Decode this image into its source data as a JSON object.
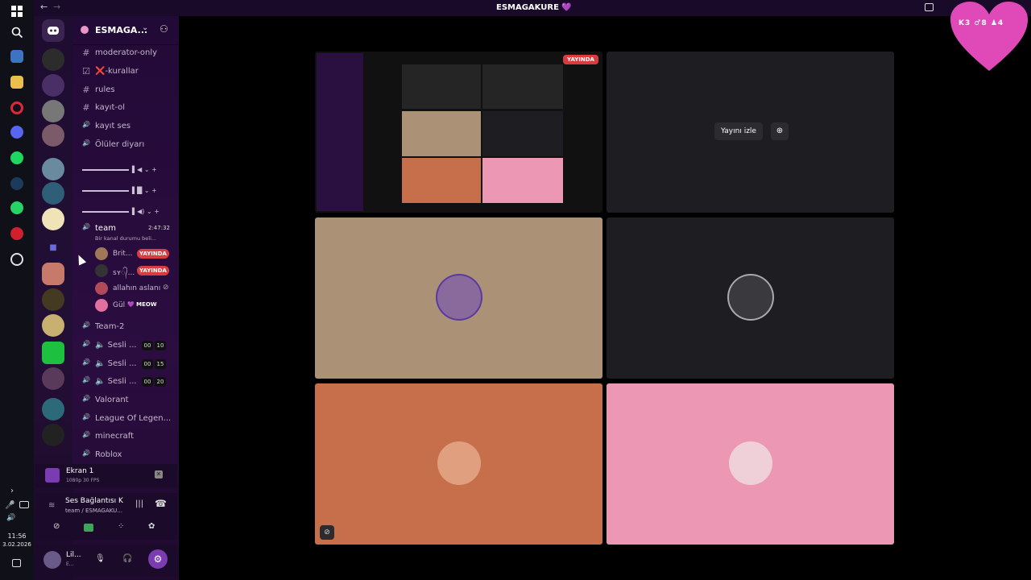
{
  "window": {
    "title": "ESMAGAKURE 💜",
    "nav_back": "←",
    "nav_forward": "→"
  },
  "server": {
    "name": "ESMAGA..."
  },
  "channels": [
    {
      "icon": "#",
      "label": "moderator-only"
    },
    {
      "icon": "☑",
      "label": "❌-kurallar"
    },
    {
      "icon": "#",
      "label": "rules"
    },
    {
      "icon": "#",
      "label": "kayıt-ol"
    },
    {
      "icon": "🔊",
      "label": "kayıt ses"
    },
    {
      "icon": "🔊",
      "label": "Ölüler diyarı"
    }
  ],
  "team_channel": {
    "label": "team",
    "timer": "2:47:32",
    "status": "Bir kanal durumu beli..."
  },
  "voice_users": [
    {
      "name": "Brit...",
      "badge": "YAYINDA"
    },
    {
      "name": "ꜱʏ᭄...",
      "badge": "YAYINDA"
    },
    {
      "name": "allahın aslanı",
      "badge": ""
    },
    {
      "name": "Gül",
      "badge": "💜 MEOW"
    }
  ],
  "channels2": [
    {
      "icon": "🔊",
      "label": "Team-2",
      "a": "",
      "b": ""
    },
    {
      "icon": "🔊",
      "label": "🔈 Sesli ...",
      "a": "00",
      "b": "10"
    },
    {
      "icon": "🔊",
      "label": "🔈 Sesli ...",
      "a": "00",
      "b": "15"
    },
    {
      "icon": "🔊",
      "label": "🔈 Sesli ...",
      "a": "00",
      "b": "20"
    },
    {
      "icon": "🔊",
      "label": "Valorant",
      "a": "",
      "b": ""
    },
    {
      "icon": "🔊",
      "label": "League Of Legen...",
      "a": "",
      "b": ""
    },
    {
      "icon": "🔊",
      "label": "minecraft",
      "a": "",
      "b": ""
    },
    {
      "icon": "🔊",
      "label": "Roblox",
      "a": "",
      "b": ""
    }
  ],
  "screen_share": {
    "title": "Ekran 1",
    "quality": "1080p 30 FPS"
  },
  "voice_connection": {
    "title": "Ses Bağlantısı K",
    "subtitle": "team / ESMAGAKU..."
  },
  "account": {
    "name": "Lil...",
    "status": "E..."
  },
  "stream_tile": {
    "live_label": "YAYINDA"
  },
  "watch_tile": {
    "button": "Yayını izle"
  },
  "heart_stats": "K3  ♂8  ♟4",
  "clock": {
    "time": "11:56",
    "date": "3.02.2026"
  },
  "colors": {
    "tile_tan": "#ab9276",
    "tile_dark": "#1e1e22",
    "tile_orange": "#c76e4a",
    "tile_pink": "#ec97b3",
    "live_red": "#d83c3e",
    "accent": "#e04ab8"
  }
}
